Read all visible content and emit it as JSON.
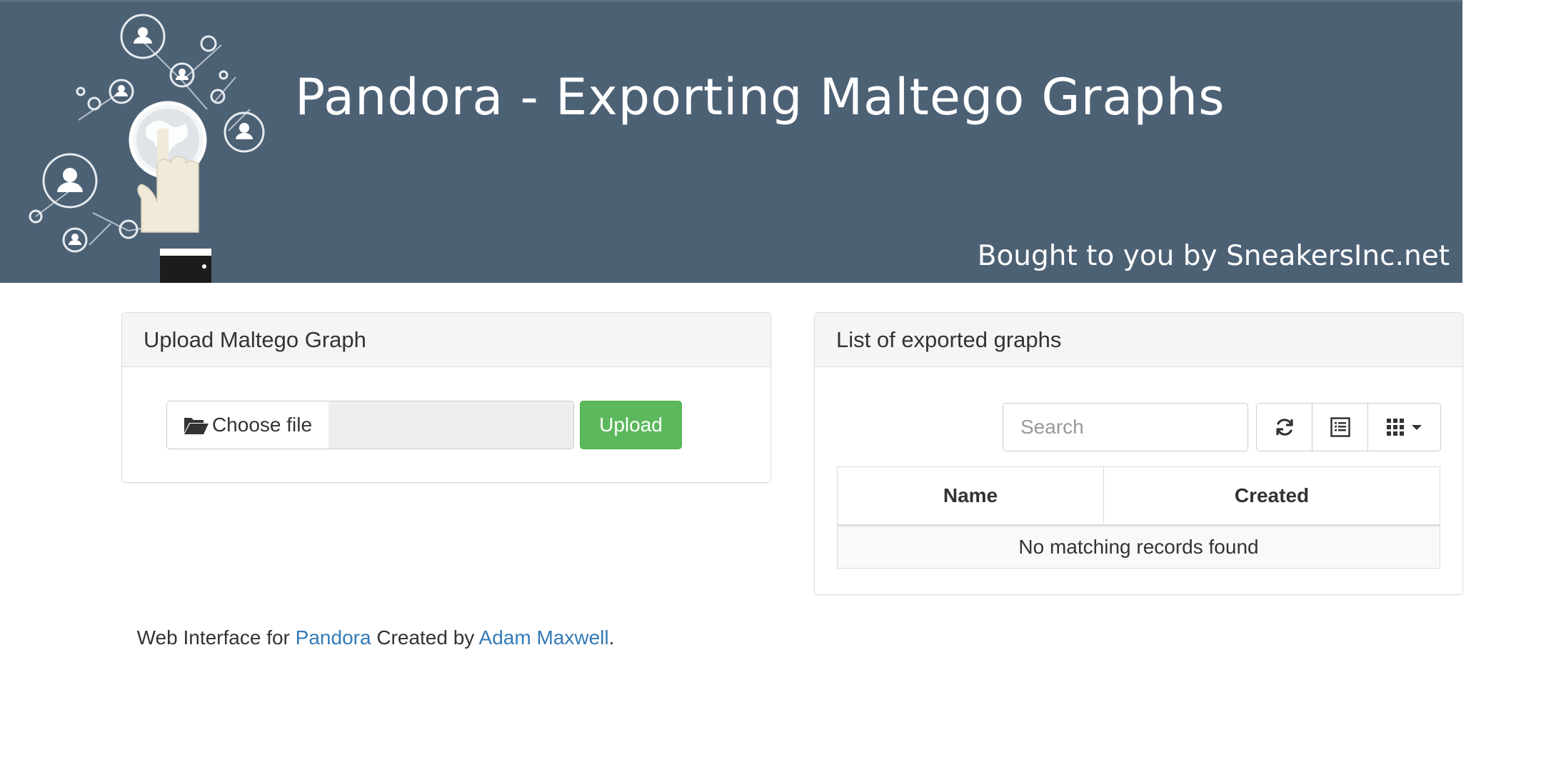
{
  "banner": {
    "title": "Pandora - Exporting Maltego Graphs",
    "tagline": "Bought to you by SneakersInc.net",
    "background_color": "#4d6175"
  },
  "upload_panel": {
    "heading": "Upload Maltego Graph",
    "choose_file_label": "Choose file",
    "choose_file_icon": "folder-open-icon",
    "file_path_value": "",
    "upload_label": "Upload",
    "upload_color": "#5cb85c"
  },
  "list_panel": {
    "heading": "List of exported graphs",
    "search_placeholder": "Search",
    "toolbar_icons": [
      "refresh-icon",
      "list-view-icon",
      "columns-grid-icon"
    ],
    "columns": [
      "Name",
      "Created"
    ],
    "empty_message": "No matching records found"
  },
  "footer": {
    "prefix": "Web Interface for",
    "link1": "Pandora",
    "middle": "Created by",
    "link2": "Adam Maxwell",
    "suffix": ".",
    "link_color": "#337ab7"
  }
}
